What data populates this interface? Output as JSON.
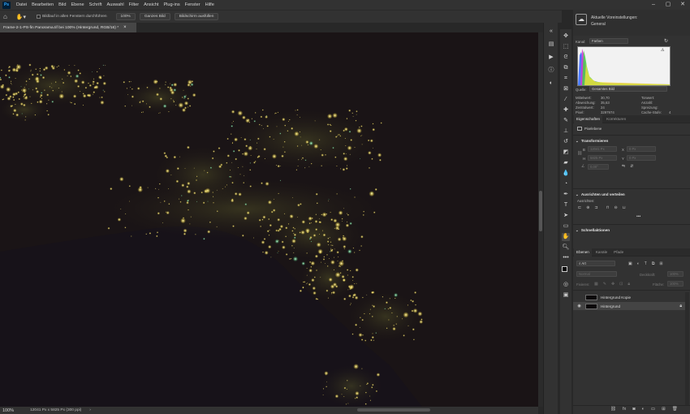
{
  "app": {
    "logo": "Ps",
    "menu": [
      "Datei",
      "Bearbeiten",
      "Bild",
      "Ebene",
      "Schrift",
      "Auswahl",
      "Filter",
      "Ansicht",
      "Plug-ins",
      "Fenster",
      "Hilfe"
    ],
    "window_controls": [
      "–",
      "▢",
      "✕"
    ]
  },
  "options_bar": {
    "scroll_all_label": "Bildlauf in allen Fenstern durchführen",
    "zoom_100_label": "100%",
    "fit_label": "Ganzes Bild",
    "fill_label": "Bildschirm ausfüllen"
  },
  "document": {
    "tab_title": "Frame-2-1-PS-fin Panorama.tif bei 100% (Hintergrund, RGB/16) *",
    "close_glyph": "×"
  },
  "status_bar": {
    "zoom": "100%",
    "doc_size": "12041 Px x 5825 Px (300 ppi)",
    "arrow": "›"
  },
  "colors": {
    "menu_bg": "#323232",
    "canvas_night": "#1a1416",
    "city_light": "#fff08a",
    "histogram_blue": "#3a6cff",
    "histogram_magenta": "#d23ad2",
    "histogram_green": "#45d14a",
    "histogram_yellow": "#f0e23a"
  },
  "histogram_panel": {
    "preset_line1": "Aktuelle Voreinstellungen:",
    "preset_line2": "General",
    "channel_label": "Kanal:",
    "channel_value": "Farben",
    "source_label": "Quelle:",
    "source_value": "Gesamtes Bild",
    "stats_left": [
      {
        "label": "Mittelwert:",
        "value": "30,70"
      },
      {
        "label": "Abweichung:",
        "value": "35,63"
      },
      {
        "label": "Zentralwert:",
        "value": "24"
      },
      {
        "label": "Pixel:",
        "value": "3297974"
      }
    ],
    "stats_right": [
      {
        "label": "Tonwert:",
        "value": ""
      },
      {
        "label": "Anzahl:",
        "value": ""
      },
      {
        "label": "Spreizung:",
        "value": ""
      },
      {
        "label": "Cache-Stufe:",
        "value": "4"
      }
    ]
  },
  "properties_panel": {
    "tabs": [
      "Eigenschaften",
      "Korrekturen"
    ],
    "kind": "Pixelebene",
    "transform_title": "Transformieren",
    "w_label": "B",
    "w_value": "12041 Px",
    "x_label": "X",
    "x_value": "0 Px",
    "h_label": "H",
    "h_value": "5825 Px",
    "y_label": "Y",
    "y_value": "0 Px",
    "angle_value": "0,00°",
    "align_title": "Ausrichten und verteilen",
    "align_sub": "Ausrichten:",
    "more": "•••",
    "quick_title": "Schnellaktionen"
  },
  "layers_panel": {
    "tabs": [
      "Ebenen",
      "Kanäle",
      "Pfade"
    ],
    "filter_value": "Art",
    "blend_mode": "Normal",
    "opacity_label": "Deckkraft:",
    "opacity_value": "100%",
    "lock_label": "Fixieren:",
    "fill_label": "Fläche:",
    "fill_value": "100%",
    "layers": [
      {
        "name": "Hintergrund Kopie",
        "visible": false
      },
      {
        "name": "Hintergrund",
        "visible": true
      }
    ],
    "footer_icons": [
      "link-icon",
      "fx-icon",
      "mask-icon",
      "adjustment-icon",
      "group-icon",
      "new-layer-icon",
      "trash-icon"
    ]
  }
}
